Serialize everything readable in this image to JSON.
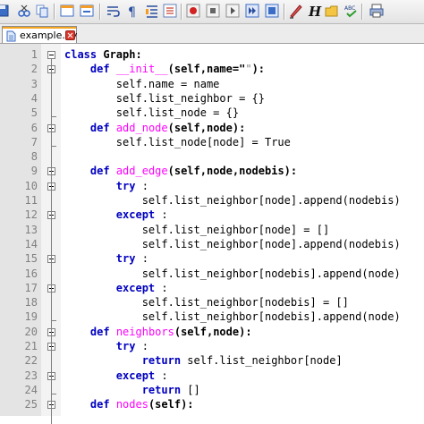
{
  "toolbar": {
    "icons": [
      "open-file-icon",
      "close-file-icon",
      "close-all-icon",
      "print-icon",
      "cut-icon",
      "copy-icon",
      "paste-icon",
      "undo-icon",
      "redo-icon",
      "find-icon",
      "replace-icon",
      "zoom-in-icon",
      "zoom-out-icon",
      "sync-scroll-icon",
      "wrap-icon",
      "show-all-chars-icon",
      "indent-guide-icon",
      "record-macro-icon",
      "stop-record-icon",
      "play-macro-icon",
      "play-multiple-icon",
      "save-macro-icon",
      "highlight-icon",
      "bold-h-icon",
      "folder-icon",
      "spell-check-icon",
      "print-preview-icon"
    ]
  },
  "tab": {
    "label": "example.py"
  },
  "editor": {
    "lines": [
      {
        "n": "1",
        "segs": [
          [
            "kw",
            "class"
          ],
          [
            "op",
            " Graph:"
          ]
        ]
      },
      {
        "n": "2",
        "segs": [
          [
            "plain",
            "    "
          ],
          [
            "kw",
            "def"
          ],
          [
            "plain",
            " "
          ],
          [
            "fn",
            "__init__"
          ],
          [
            "op",
            "(self,name=\""
          ],
          [
            "str",
            "\""
          ],
          [
            "op",
            "):"
          ]
        ]
      },
      {
        "n": "3",
        "segs": [
          [
            "plain",
            "        self.name = name"
          ]
        ]
      },
      {
        "n": "4",
        "segs": [
          [
            "plain",
            "        self.list_neighbor = {}"
          ]
        ]
      },
      {
        "n": "5",
        "segs": [
          [
            "plain",
            "        self.list_node = {}"
          ]
        ]
      },
      {
        "n": "6",
        "segs": [
          [
            "plain",
            "    "
          ],
          [
            "kw",
            "def"
          ],
          [
            "plain",
            " "
          ],
          [
            "fn",
            "add_node"
          ],
          [
            "op",
            "(self,node):"
          ]
        ]
      },
      {
        "n": "7",
        "segs": [
          [
            "plain",
            "        self.list_node[node] = True"
          ]
        ]
      },
      {
        "n": "8",
        "segs": [
          [
            "plain",
            ""
          ]
        ]
      },
      {
        "n": "9",
        "segs": [
          [
            "plain",
            "    "
          ],
          [
            "kw",
            "def"
          ],
          [
            "plain",
            " "
          ],
          [
            "fn",
            "add_edge"
          ],
          [
            "op",
            "(self,node,nodebis):"
          ]
        ]
      },
      {
        "n": "10",
        "segs": [
          [
            "plain",
            "        "
          ],
          [
            "kw",
            "try"
          ],
          [
            "plain",
            " :"
          ]
        ]
      },
      {
        "n": "11",
        "segs": [
          [
            "plain",
            "            self.list_neighbor[node].append(nodebis)"
          ]
        ]
      },
      {
        "n": "12",
        "segs": [
          [
            "plain",
            "        "
          ],
          [
            "kw",
            "except"
          ],
          [
            "plain",
            " :"
          ]
        ]
      },
      {
        "n": "13",
        "segs": [
          [
            "plain",
            "            self.list_neighbor[node] = []"
          ]
        ]
      },
      {
        "n": "14",
        "segs": [
          [
            "plain",
            "            self.list_neighbor[node].append(nodebis)"
          ]
        ]
      },
      {
        "n": "15",
        "segs": [
          [
            "plain",
            "        "
          ],
          [
            "kw",
            "try"
          ],
          [
            "plain",
            " :"
          ]
        ]
      },
      {
        "n": "16",
        "segs": [
          [
            "plain",
            "            self.list_neighbor[nodebis].append(node)"
          ]
        ]
      },
      {
        "n": "17",
        "segs": [
          [
            "plain",
            "        "
          ],
          [
            "kw",
            "except"
          ],
          [
            "plain",
            " :"
          ]
        ]
      },
      {
        "n": "18",
        "segs": [
          [
            "plain",
            "            self.list_neighbor[nodebis] = []"
          ]
        ]
      },
      {
        "n": "19",
        "segs": [
          [
            "plain",
            "            self.list_neighbor[nodebis].append(node)"
          ]
        ]
      },
      {
        "n": "20",
        "segs": [
          [
            "plain",
            "    "
          ],
          [
            "kw",
            "def"
          ],
          [
            "plain",
            " "
          ],
          [
            "fn",
            "neighbors"
          ],
          [
            "op",
            "(self,node):"
          ]
        ]
      },
      {
        "n": "21",
        "segs": [
          [
            "plain",
            "        "
          ],
          [
            "kw",
            "try"
          ],
          [
            "plain",
            " :"
          ]
        ]
      },
      {
        "n": "22",
        "segs": [
          [
            "plain",
            "            "
          ],
          [
            "kw",
            "return"
          ],
          [
            "plain",
            " self.list_neighbor[node]"
          ]
        ]
      },
      {
        "n": "23",
        "segs": [
          [
            "plain",
            "        "
          ],
          [
            "kw",
            "except"
          ],
          [
            "plain",
            " :"
          ]
        ]
      },
      {
        "n": "24",
        "segs": [
          [
            "plain",
            "            "
          ],
          [
            "kw",
            "return"
          ],
          [
            "plain",
            " []"
          ]
        ]
      },
      {
        "n": "25",
        "segs": [
          [
            "plain",
            "    "
          ],
          [
            "kw",
            "def"
          ],
          [
            "plain",
            " "
          ],
          [
            "fn",
            "nodes"
          ],
          [
            "op",
            "(self):"
          ]
        ]
      }
    ]
  }
}
